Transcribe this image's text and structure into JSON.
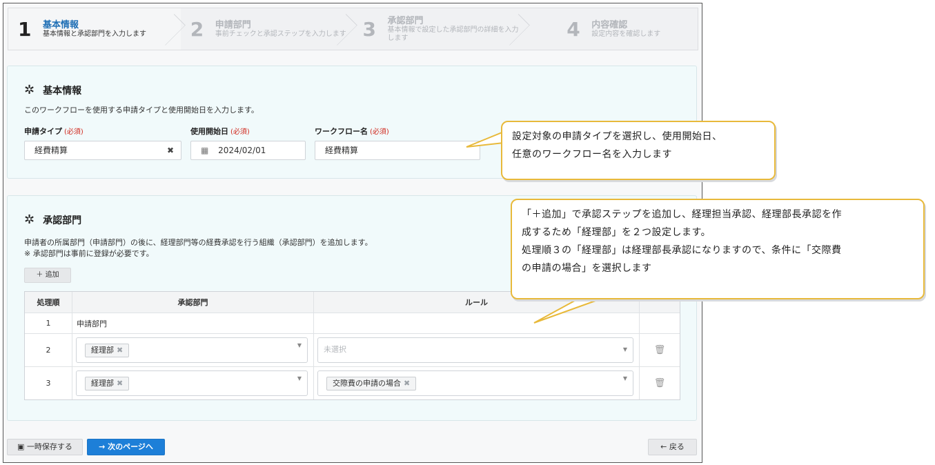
{
  "steps": [
    {
      "num": "1",
      "title": "基本情報",
      "sub": "基本情報と承認部門を入力します"
    },
    {
      "num": "2",
      "title": "申請部門",
      "sub": "事前チェックと承認ステップを入力します"
    },
    {
      "num": "3",
      "title": "承認部門",
      "sub": "基本情報で設定した承認部門の詳細を入力します"
    },
    {
      "num": "4",
      "title": "内容確認",
      "sub": "設定内容を確認します"
    }
  ],
  "basic": {
    "heading": "基本情報",
    "description": "このワークフローを使用する申請タイプと使用開始日を入力します。",
    "required_mark": "(必須)",
    "type_label": "申請タイプ",
    "type_value": "経費精算",
    "start_label": "使用開始日",
    "start_value": "2024/02/01",
    "name_label": "ワークフロー名",
    "name_value": "経費精算"
  },
  "approval": {
    "heading": "承認部門",
    "desc_line1": "申請者の所属部門（申請部門）の後に、経理部門等の経費承認を行う組織（承認部門）を追加します。",
    "desc_line2": "※ 承認部門は事前に登録が必要です。",
    "add_label": "＋ 追加",
    "columns": [
      "処理順",
      "承認部門",
      "ルール"
    ],
    "rows": [
      {
        "order": "1",
        "dept": "申請部門"
      },
      {
        "order": "2",
        "dept_tag": "経理部",
        "rule_placeholder": "未選択"
      },
      {
        "order": "3",
        "dept_tag": "経理部",
        "rule_tag": "交際費の申請の場合"
      }
    ]
  },
  "buttons": {
    "save": "一時保存する",
    "next": "→ 次のページへ",
    "back": "← 戻る"
  },
  "callouts": {
    "first_line1": "設定対象の申請タイプを選択し、使用開始日、",
    "first_line2": "任意のワークフロー名を入力します",
    "second_line1": "「＋追加」で承認ステップを追加し、経理担当承認、経理部長承認を作",
    "second_line2": "成するため「経理部」を２つ設定します。",
    "second_line3": "処理順３の「経理部」は経理部長承認になりますので、条件に「交際費",
    "second_line4": "の申請の場合」を選択します"
  },
  "colors": {
    "accent": "#1d7fd8",
    "required": "#d0261b",
    "callout_border": "#e8b93a"
  }
}
